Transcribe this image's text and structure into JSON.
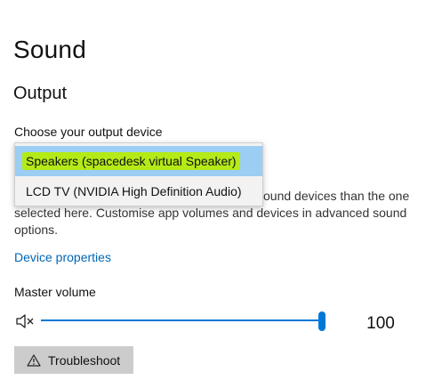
{
  "page": {
    "title": "Sound",
    "section_title": "Output"
  },
  "output": {
    "choose_label": "Choose your output device",
    "help_text": "ound devices than the one selected here. Customise app volumes and devices in advanced sound options.",
    "help_line1": "ound devices than the one",
    "help_line2": "selected here. Customise app volumes and devices in advanced sound",
    "help_line3": "options.",
    "device_properties_link": "Device properties",
    "dropdown": {
      "options": [
        {
          "label": "Speakers (spacedesk virtual Speaker)",
          "selected": true
        },
        {
          "label": "LCD  TV (NVIDIA High Definition Audio)",
          "selected": false
        }
      ]
    }
  },
  "volume": {
    "label": "Master volume",
    "value": 100,
    "value_text": "100",
    "icon": "speaker-muted-icon"
  },
  "troubleshoot": {
    "label": "Troubleshoot",
    "icon": "warning-icon"
  },
  "colors": {
    "accent": "#0078d7",
    "link": "#0066b4",
    "selected_bg": "#9ccdf2",
    "highlight": "#b4ea17",
    "button_bg": "#cccccc"
  }
}
